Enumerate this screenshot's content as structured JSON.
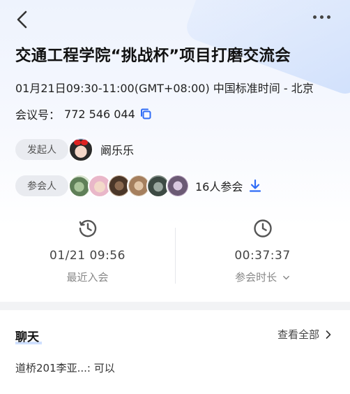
{
  "header": {
    "back_icon": "chevron-left-icon",
    "more_icon": "more-horizontal-icon"
  },
  "meeting": {
    "title": "交通工程学院“挑战杯”项目打磨交流会",
    "time": "01月21日09:30-11:00(GMT+08:00) 中国标准时间 - 北京",
    "id_label": "会议号：",
    "id_value": "772 546 044",
    "copy_icon": "copy-icon"
  },
  "initiator": {
    "pill_label": "发起人",
    "name": "阚乐乐"
  },
  "participants": {
    "pill_label": "参会人",
    "count_text": "16人参会",
    "download_icon": "download-icon"
  },
  "stats": {
    "recent_join_value": "01/21 09:56",
    "recent_join_label": "最近入会",
    "duration_value": "00:37:37",
    "duration_label": "参会时长",
    "duration_dropdown_icon": "chevron-down-icon"
  },
  "chat": {
    "title": "聊天",
    "view_all": "查看全部",
    "view_all_icon": "chevron-right-icon",
    "last_message": "道桥201李亚...: 可以"
  },
  "colors": {
    "accent": "#2f6cf6",
    "icon_gray": "#555555"
  }
}
